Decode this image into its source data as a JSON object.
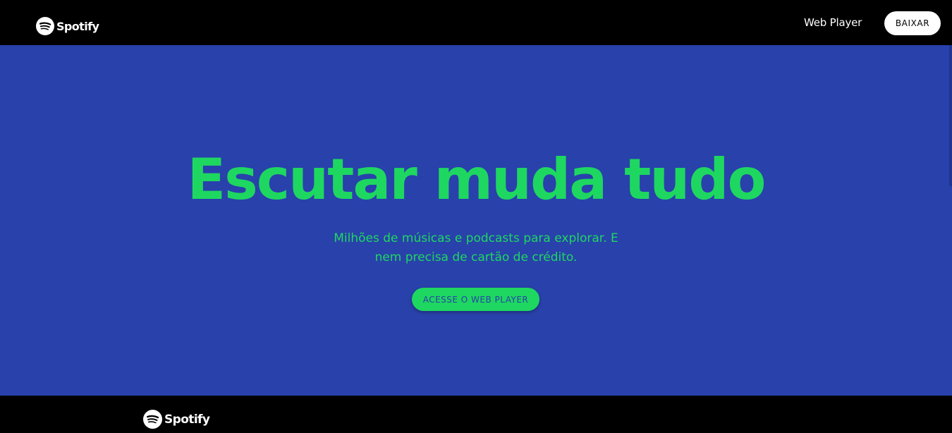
{
  "header": {
    "logo_text": "Spotify",
    "nav_web_player": "Web Player",
    "download_label": "BAIXAR"
  },
  "hero": {
    "title": "Escutar muda tudo",
    "subtitle": "Milhões de músicas e podcasts para explorar. E nem precisa de cartão de crédito.",
    "cta_label": "ACESSE O WEB PLAYER"
  },
  "footer": {
    "logo_text": "Spotify"
  },
  "icons": {
    "logo": "spotify-logo-icon"
  },
  "colors": {
    "hero_background": "#2941ab",
    "accent_green": "#1ed760",
    "bar_background": "#000000",
    "button_white": "#ffffff"
  }
}
